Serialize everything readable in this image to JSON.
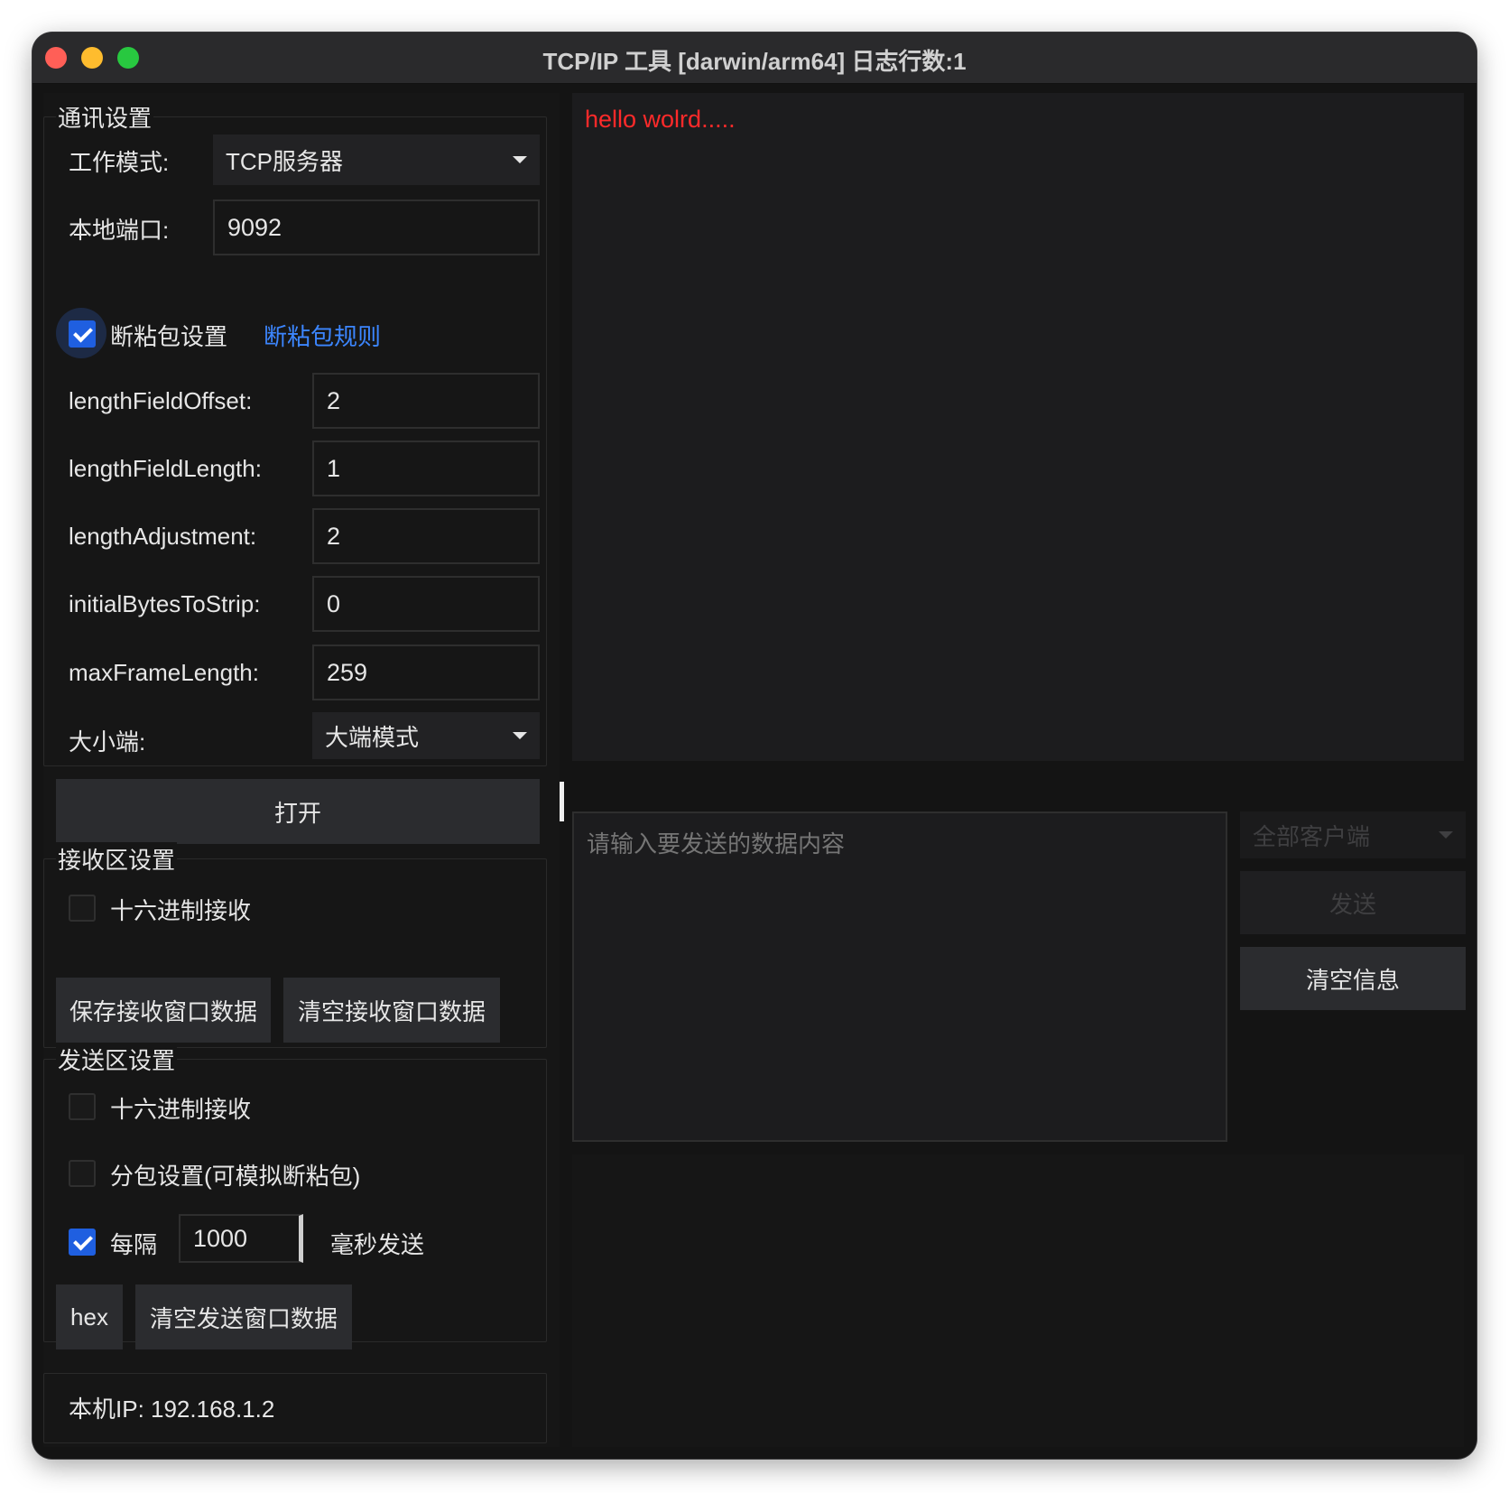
{
  "window": {
    "title": "TCP/IP 工具 [darwin/arm64] 日志行数:1"
  },
  "comm_settings": {
    "title": "通讯设置",
    "work_mode_label": "工作模式:",
    "work_mode_value": "TCP服务器",
    "local_port_label": "本地端口:",
    "local_port_value": "9092",
    "sticky_packet_checkbox_label": "断粘包设置",
    "sticky_packet_checked": true,
    "sticky_rules_link": "断粘包规则",
    "length_field_offset_label": "lengthFieldOffset:",
    "length_field_offset_value": "2",
    "length_field_length_label": "lengthFieldLength:",
    "length_field_length_value": "1",
    "length_adjustment_label": "lengthAdjustment:",
    "length_adjustment_value": "2",
    "initial_bytes_to_strip_label": "initialBytesToStrip:",
    "initial_bytes_to_strip_value": "0",
    "max_frame_length_label": "maxFrameLength:",
    "max_frame_length_value": "259",
    "endianness_label": "大小端:",
    "endianness_value": "大端模式",
    "open_button": "打开"
  },
  "receive_settings": {
    "title": "接收区设置",
    "hex_receive_label": "十六进制接收",
    "hex_receive_checked": false,
    "save_button": "保存接收窗口数据",
    "clear_button": "清空接收窗口数据"
  },
  "send_settings": {
    "title": "发送区设置",
    "hex_label": "十六进制接收",
    "hex_checked": false,
    "split_packet_label": "分包设置(可模拟断粘包)",
    "split_packet_checked": false,
    "interval_label": "每隔",
    "interval_checked": true,
    "interval_value": "1000",
    "interval_suffix": "毫秒发送",
    "hex_button": "hex",
    "clear_button": "清空发送窗口数据"
  },
  "status": {
    "local_ip": "本机IP:  192.168.1.2"
  },
  "log": {
    "lines": [
      "hello wolrd....."
    ]
  },
  "send_area": {
    "placeholder": "请输入要发送的数据内容",
    "client_select_value": "全部客户端",
    "send_button": "发送",
    "clear_info_button": "清空信息"
  }
}
